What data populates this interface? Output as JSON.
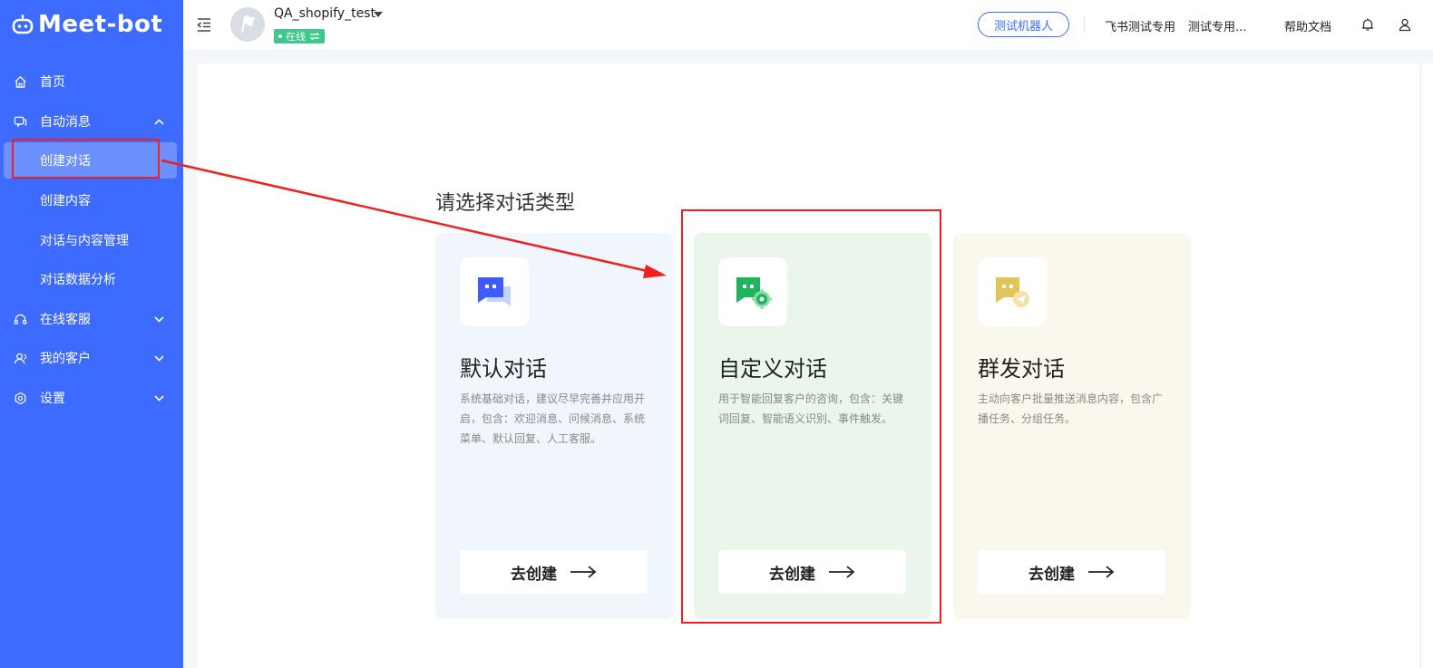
{
  "brand": {
    "name": "Meet-bot"
  },
  "sidebar": {
    "items": [
      {
        "label": "首页",
        "icon": "home-icon"
      },
      {
        "label": "自动消息",
        "icon": "chat-icon",
        "expanded": true,
        "children": [
          {
            "label": "创建对话",
            "active": true
          },
          {
            "label": "创建内容"
          },
          {
            "label": "对话与内容管理"
          },
          {
            "label": "对话数据分析"
          }
        ]
      },
      {
        "label": "在线客服",
        "icon": "headset-icon"
      },
      {
        "label": "我的客户",
        "icon": "user-icon"
      },
      {
        "label": "设置",
        "icon": "gear-icon"
      }
    ]
  },
  "header": {
    "account_name": "QA_shopify_test",
    "status": "在线",
    "test_robot_label": "测试机器人",
    "links": [
      "飞书测试专用",
      "测试专用...",
      "帮助文档"
    ]
  },
  "main": {
    "heading": "请选择对话类型",
    "cards": [
      {
        "title": "默认对话",
        "desc": "系统基础对话，建议尽早完善并应用开启，包含：欢迎消息、问候消息、系统菜单、默认回复、人工客服。",
        "button": "去创建",
        "icon": "default-chat-icon",
        "accent": "#3d5bff",
        "bg": "#f1f6fd"
      },
      {
        "title": "自定义对话",
        "desc": "用于智能回复客户的咨询，包含：关键词回复、智能语义识别、事件触发。",
        "button": "去创建",
        "icon": "custom-chat-icon",
        "accent": "#1fb35a",
        "bg": "#eaf5ec"
      },
      {
        "title": "群发对话",
        "desc": "主动向客户批量推送消息内容，包含广播任务、分组任务。",
        "button": "去创建",
        "icon": "broadcast-chat-icon",
        "accent": "#e3c458",
        "bg": "#faf8ec"
      }
    ]
  },
  "colors": {
    "primary": "#3d6bff",
    "online": "#3ec88c",
    "annotation": "#ee2020"
  }
}
